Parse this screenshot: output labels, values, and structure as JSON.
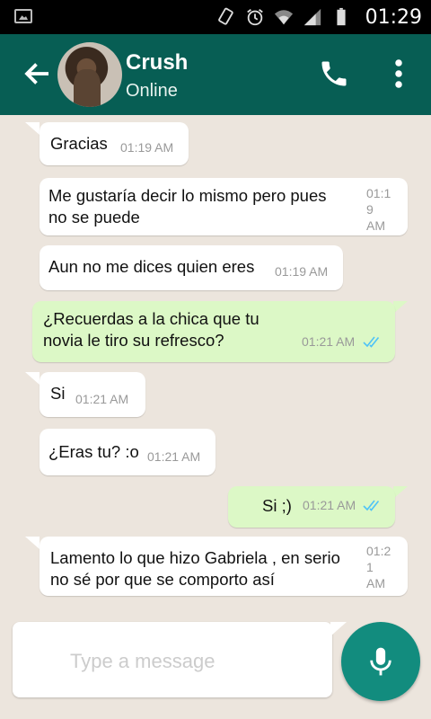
{
  "status_bar": {
    "time": "01:29"
  },
  "header": {
    "contact_name": "Crush",
    "contact_status": "Online"
  },
  "messages": [
    {
      "direction": "in",
      "text": "Gracias",
      "time": "01:19 AM"
    },
    {
      "direction": "in",
      "text": "Me gustaría decir lo mismo pero pues\nno se puede",
      "time": "01:1\n9\nAM"
    },
    {
      "direction": "in",
      "text": "Aun no me dices quien eres",
      "time": "01:19 AM"
    },
    {
      "direction": "out",
      "text": "¿Recuerdas a la chica que tu\nnovia le tiro su refresco?",
      "time": "01:21 AM"
    },
    {
      "direction": "in",
      "text": "Si",
      "time": "01:21 AM"
    },
    {
      "direction": "in",
      "text": "¿Eras tu? :o",
      "time": "01:21 AM"
    },
    {
      "direction": "out",
      "text": "Si ;)",
      "time": "01:21 AM"
    },
    {
      "direction": "in",
      "text": "Lamento lo que hizo Gabriela , en serio\nno sé por que se comporto así",
      "time": "01:2\n1\nAM"
    }
  ],
  "composer": {
    "placeholder": "Type a message",
    "value": ""
  },
  "colors": {
    "header": "#075E54",
    "accent": "#128C7E",
    "outgoing_bubble": "#DCF8C6",
    "read_ticks": "#4FC3F7"
  }
}
